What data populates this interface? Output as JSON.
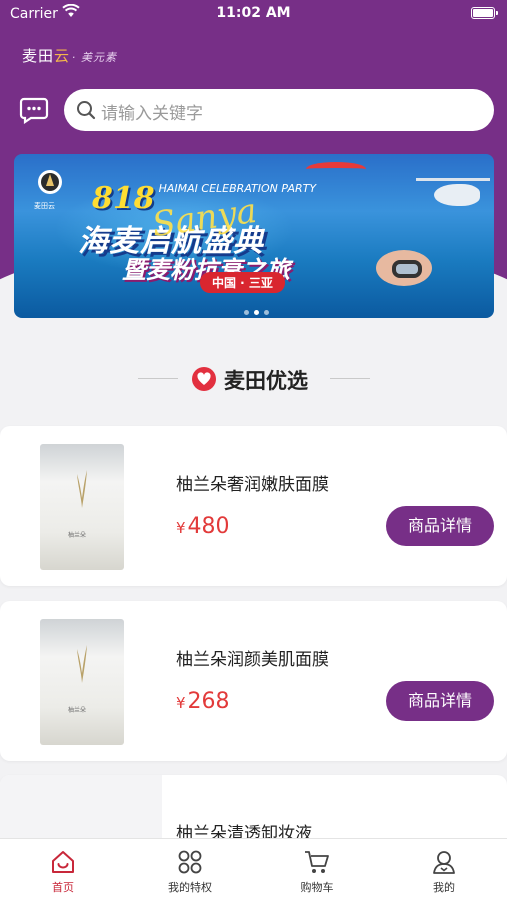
{
  "status_bar": {
    "carrier": "Carrier",
    "time": "11:02 AM"
  },
  "header": {
    "brand_main": "麦田",
    "brand_accent": "云",
    "brand_sub": "· 美元素",
    "search_placeholder": "请输入关键字"
  },
  "banner": {
    "number": "818",
    "party_text": "HAIMAI CELEBRATION PARTY",
    "headline": "海麦启航盛典",
    "script_text": "Sanya",
    "subline": "暨麦粉抗衰之旅",
    "location_tag": "中国 · 三亚",
    "logo_text": "麦田云",
    "pages": 3,
    "active_page": 1
  },
  "section": {
    "title": "麦田优选",
    "accent": "#e2303f"
  },
  "products": [
    {
      "name": "柚兰朵奢润嫩肤面膜",
      "currency": "¥",
      "price": "480",
      "detail_label": "商品详情",
      "pack_label": "柚兰朵"
    },
    {
      "name": "柚兰朵润颜美肌面膜",
      "currency": "¥",
      "price": "268",
      "detail_label": "商品详情",
      "pack_label": "柚兰朵"
    },
    {
      "name": "柚兰朵清透卸妆液"
    }
  ],
  "tabbar": {
    "items": [
      {
        "label": "首页",
        "icon": "home-icon",
        "active": true
      },
      {
        "label": "我的特权",
        "icon": "grid-icon",
        "active": false
      },
      {
        "label": "购物车",
        "icon": "cart-icon",
        "active": false
      },
      {
        "label": "我的",
        "icon": "user-icon",
        "active": false
      }
    ]
  },
  "colors": {
    "brand_purple": "#772f87",
    "price_red": "#e23a3a",
    "active_tab": "#c8283a"
  }
}
